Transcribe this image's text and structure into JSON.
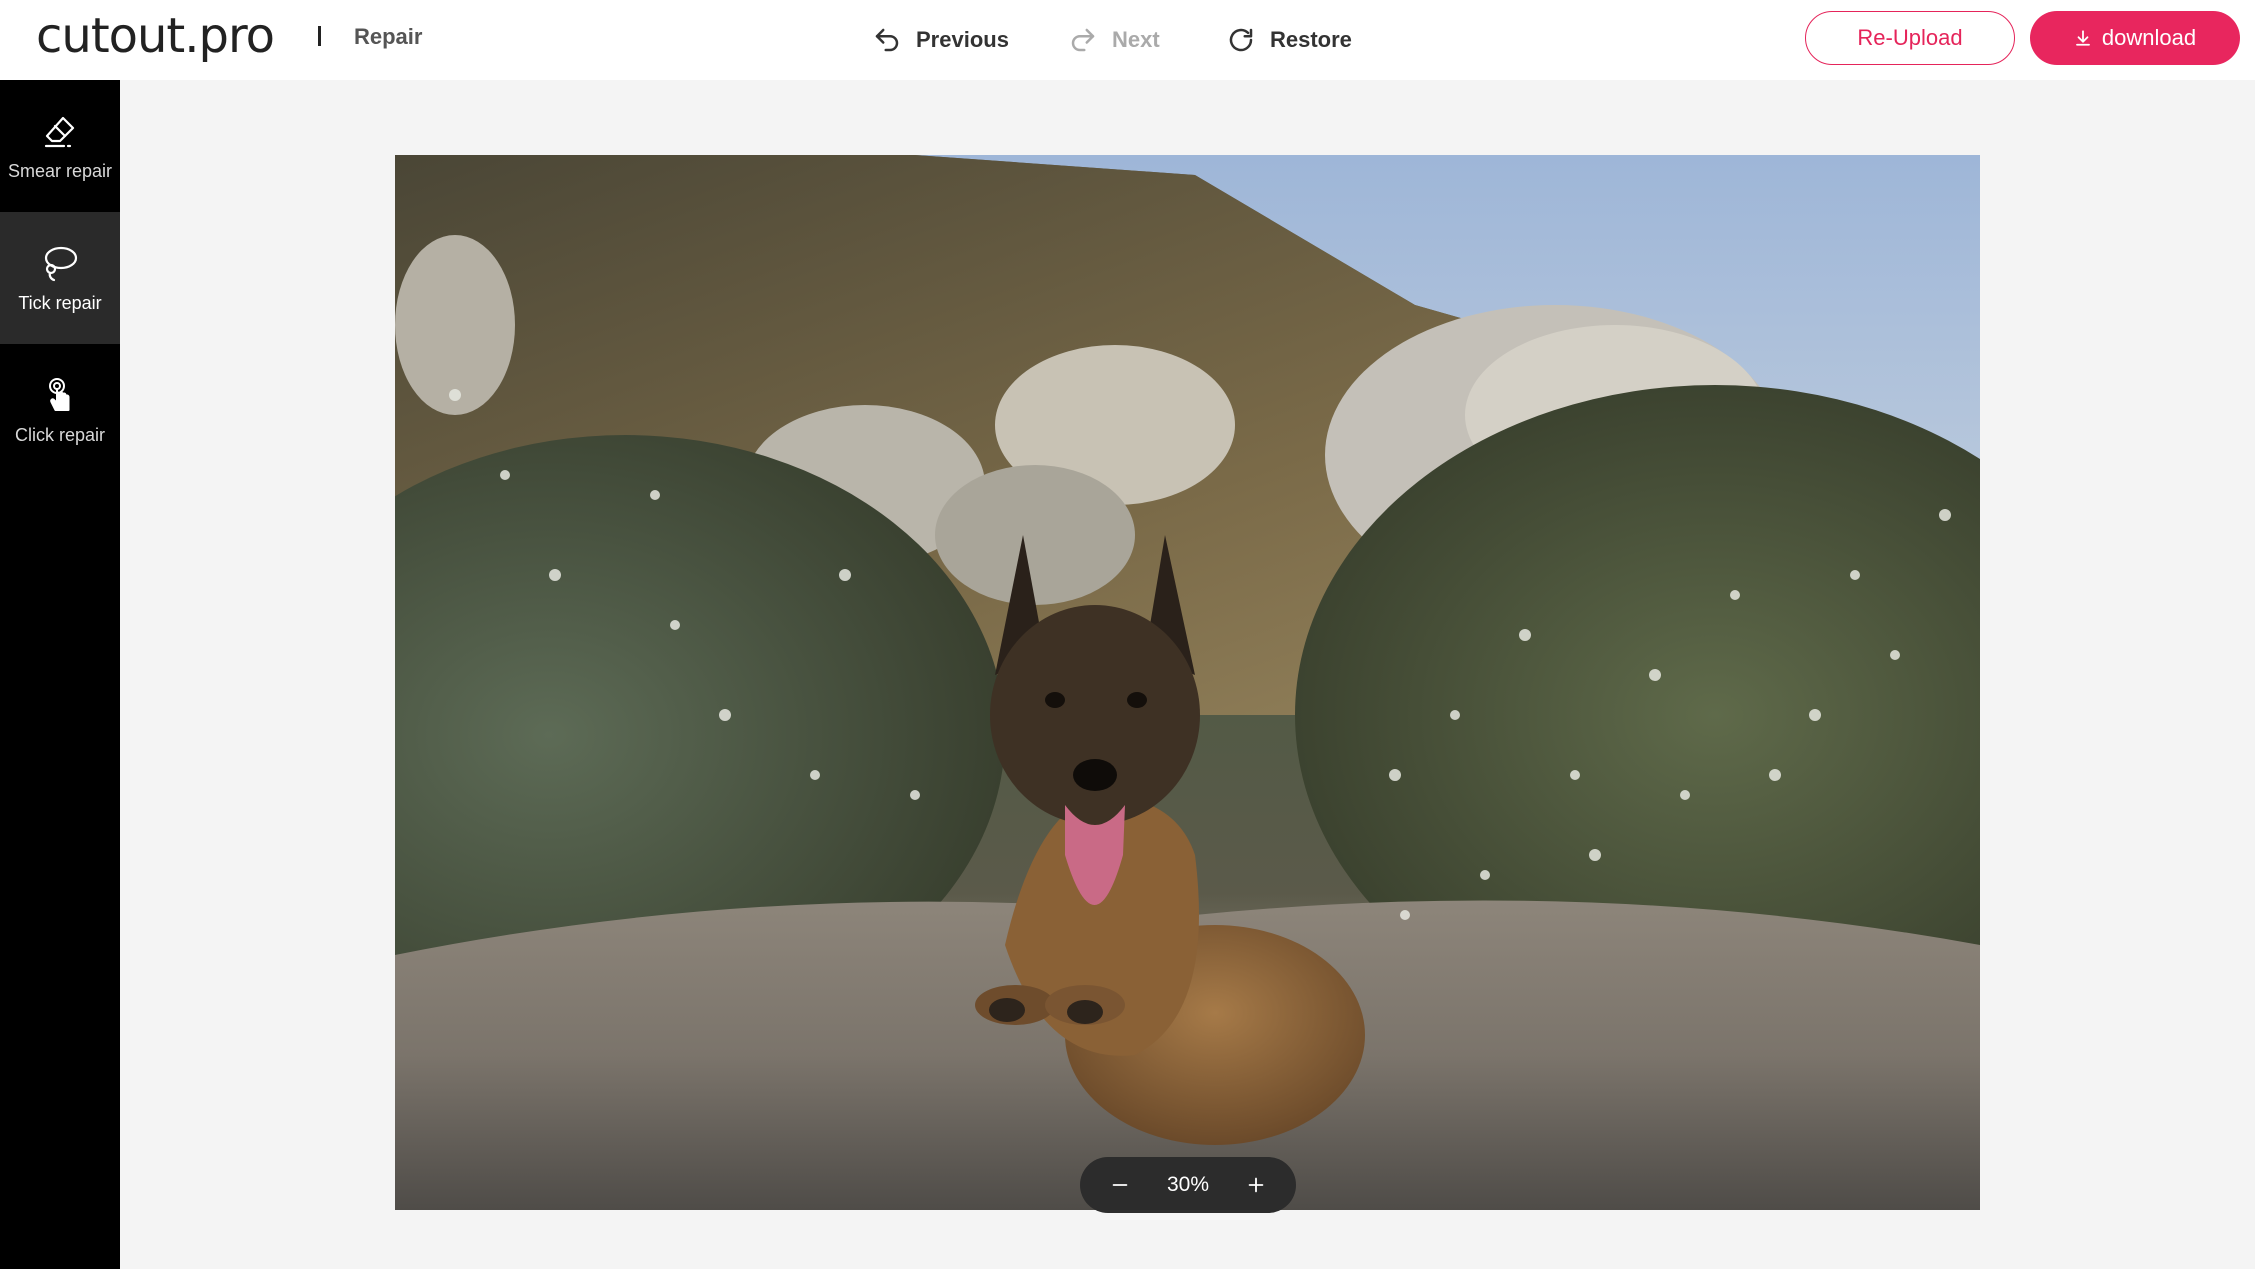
{
  "header": {
    "logo": "cutout.pro",
    "page_label": "Repair",
    "history": {
      "previous": "Previous",
      "next": "Next",
      "restore": "Restore"
    },
    "reupload_label": "Re-Upload",
    "download_label": "download"
  },
  "sidebar": {
    "tools": [
      {
        "label": "Smear repair",
        "icon": "eraser-icon",
        "active": false
      },
      {
        "label": "Tick repair",
        "icon": "lasso-icon",
        "active": true
      },
      {
        "label": "Click repair",
        "icon": "tap-hand-icon",
        "active": false
      }
    ]
  },
  "canvas": {
    "zoom_level": "30%"
  },
  "colors": {
    "accent": "#e8265e",
    "sidebar_bg": "#000000",
    "sidebar_active": "#2a2a2a",
    "canvas_bg": "#f4f4f4"
  }
}
